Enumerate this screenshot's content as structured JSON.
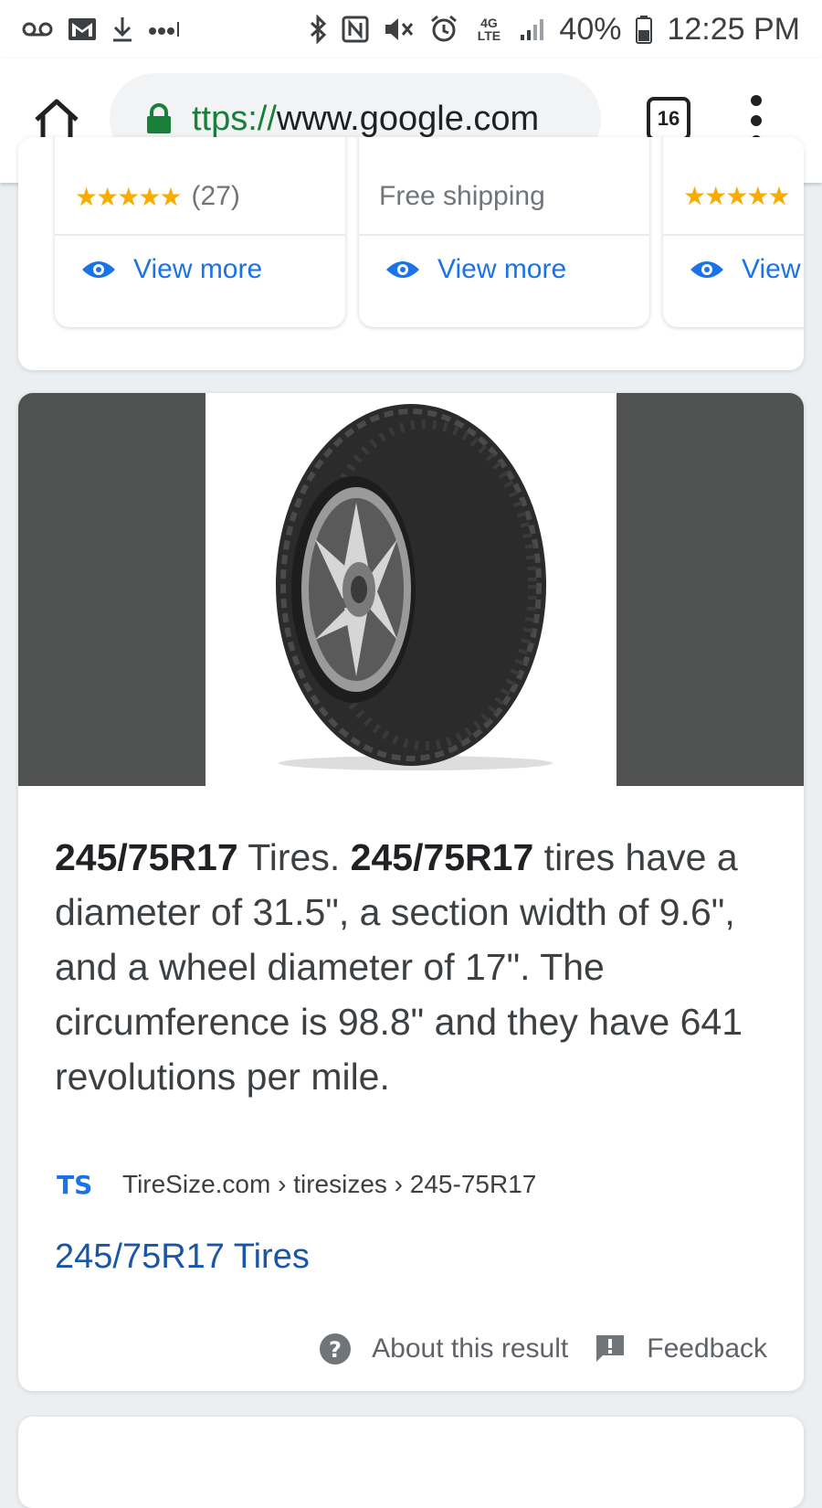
{
  "status_bar": {
    "battery": "40%",
    "time": "12:25 PM",
    "network": "4G LTE",
    "icons": [
      "voicemail-icon",
      "gmail-icon",
      "download-icon",
      "more-notifications-icon",
      "bluetooth-icon",
      "nfc-icon",
      "vibrate-icon",
      "alarm-icon",
      "network-4g-icon",
      "signal-icon",
      "battery-icon"
    ]
  },
  "browser": {
    "url_scheme": "ttps://",
    "url_host": "www.google.com",
    "tab_count": "16"
  },
  "shopping": {
    "products": [
      {
        "rating": "★★★★★",
        "reviews": "(27)",
        "view_more": "View more"
      },
      {
        "shipping": "Free shipping",
        "view_more": "View more"
      },
      {
        "rating": "★★★★★",
        "view_more": "View"
      }
    ]
  },
  "answer": {
    "bold_term": "245/75R17",
    "text_1": " Tires. ",
    "text_2": " tires have a diameter of 31.5\", a section width of 9.6\", and a wheel diameter of 17\". The circumference is 98.8\" and they have 641 revolutions per mile.",
    "source_breadcrumb": "TireSize.com › tiresizes › 245-75R17",
    "favicon_text": "TS",
    "result_title": "245/75R17 Tires",
    "about_label": "About this result",
    "feedback_label": "Feedback"
  },
  "colors": {
    "link_blue": "#1a73e8",
    "result_link": "#1a56a7",
    "star": "#f9ab00",
    "secure_green": "#188038",
    "image_bg": "#4f5250"
  }
}
